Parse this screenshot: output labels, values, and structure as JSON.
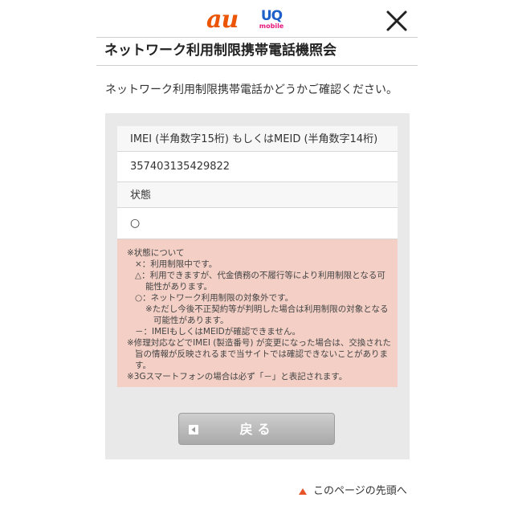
{
  "header": {
    "logo_au": "au",
    "logo_uq_main": "UQ",
    "logo_uq_sub": "mobile",
    "close_icon": "close-icon",
    "colors": {
      "au": "#eb5505",
      "uq": "#1e5fc9",
      "uq_sub": "#e6187d"
    }
  },
  "page": {
    "title": "ネットワーク利用制限携帯電話機照会",
    "intro": "ネットワーク利用制限携帯電話かどうかご確認ください。"
  },
  "result": {
    "id_label": "IMEI (半角数字15桁) もしくはMEID (半角数字14桁)",
    "id_value": "357403135429822",
    "status_label": "状態",
    "status_value": "○"
  },
  "notes": {
    "lines": [
      "※状態について",
      "×：利用制限中です。",
      "△：利用できますが、代金債務の不履行等により利用制限となる可",
      "能性があります。",
      "○：ネットワーク利用制限の対象外です。",
      "※ただし今後不正契約等が判明した場合は利用制限の対象となる",
      "可能性があります。",
      "－：IMEIもしくはMEIDが確認できません。",
      "※修理対応などでIMEI (製造番号) が変更になった場合は、交換された",
      "旨の情報が反映されるまで当サイトでは確認できないことがありま",
      "す。",
      "※3Gスマートフォンの場合は必ず「－」と表記されます。"
    ],
    "background": "#f3cfc5"
  },
  "actions": {
    "back_label": "戻る",
    "back_icon": "arrow-left-icon"
  },
  "footer": {
    "page_top_label": "このページの先頭へ",
    "page_top_icon": "triangle-up-icon",
    "icon_color": "#e8542a"
  }
}
